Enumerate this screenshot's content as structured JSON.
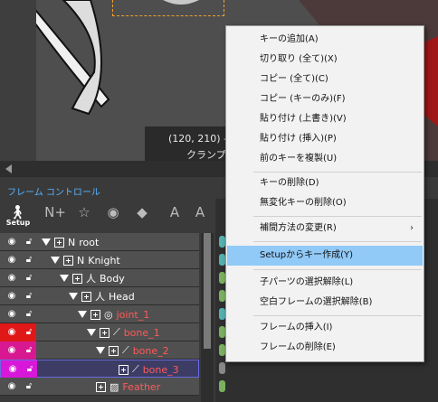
{
  "viewport": {
    "coord_text": "(120, 210) -",
    "clamp_text": "クランプ /"
  },
  "panel": {
    "title": "フレーム コントロール",
    "setup_label": "Setup"
  },
  "tree": [
    {
      "name": "root",
      "color": "#ffffff"
    },
    {
      "name": "Knight",
      "color": "#ffffff"
    },
    {
      "name": "Body",
      "color": "#ffffff"
    },
    {
      "name": "Head",
      "color": "#ffffff"
    },
    {
      "name": "joint_1",
      "color": "#ff5a5a"
    },
    {
      "name": "bone_1",
      "color": "#ff5a5a"
    },
    {
      "name": "bone_2",
      "color": "#ff5a5a"
    },
    {
      "name": "bone_3",
      "color": "#ff5a5a"
    },
    {
      "name": "Feather",
      "color": "#ff5a5a"
    }
  ],
  "menu": {
    "items": [
      "キーの追加(A)",
      "切り取り (全て)(X)",
      "コピー (全て)(C)",
      "コピー (キーのみ)(F)",
      "貼り付け (上書き)(V)",
      "貼り付け (挿入)(P)",
      "前のキーを複製(U)",
      "キーの削除(D)",
      "無変化キーの削除(O)",
      "補間方法の変更(R)",
      "Setupからキー作成(Y)",
      "子パーツの選択解除(L)",
      "空白フレームの選択解除(B)",
      "フレームの挿入(I)",
      "フレームの削除(E)"
    ],
    "highlighted": "Setupからキー作成(Y)"
  }
}
